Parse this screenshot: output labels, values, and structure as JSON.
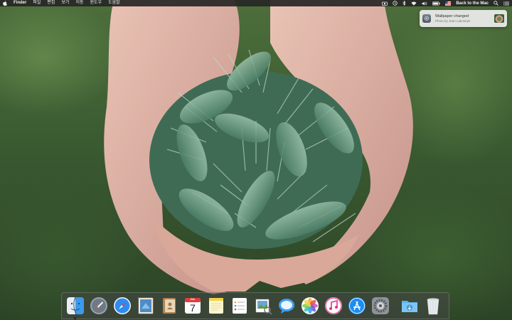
{
  "menubar": {
    "app_name": "Finder",
    "menus": [
      "파일",
      "편집",
      "보기",
      "이동",
      "윈도우",
      "도움말"
    ],
    "status_text": "Back to the Mac"
  },
  "notification": {
    "title": "Wallpaper changed",
    "body": "Photo by Jean Lakosnyk"
  },
  "calendar": {
    "day": "7",
    "month": "JUL"
  },
  "dock": {
    "items": [
      {
        "name": "finder",
        "running": true
      },
      {
        "name": "launchpad"
      },
      {
        "name": "safari"
      },
      {
        "name": "mail"
      },
      {
        "name": "contacts"
      },
      {
        "name": "calendar"
      },
      {
        "name": "notes"
      },
      {
        "name": "reminders"
      },
      {
        "name": "preview"
      },
      {
        "name": "messages"
      },
      {
        "name": "photos"
      },
      {
        "name": "itunes"
      },
      {
        "name": "app-store"
      },
      {
        "name": "system-preferences"
      },
      {
        "name": "downloads"
      },
      {
        "name": "trash"
      }
    ]
  },
  "colors": {
    "menubar_bg": "#262626",
    "dock_bg": "#464646",
    "wallpaper_green": "#3a5a31"
  }
}
